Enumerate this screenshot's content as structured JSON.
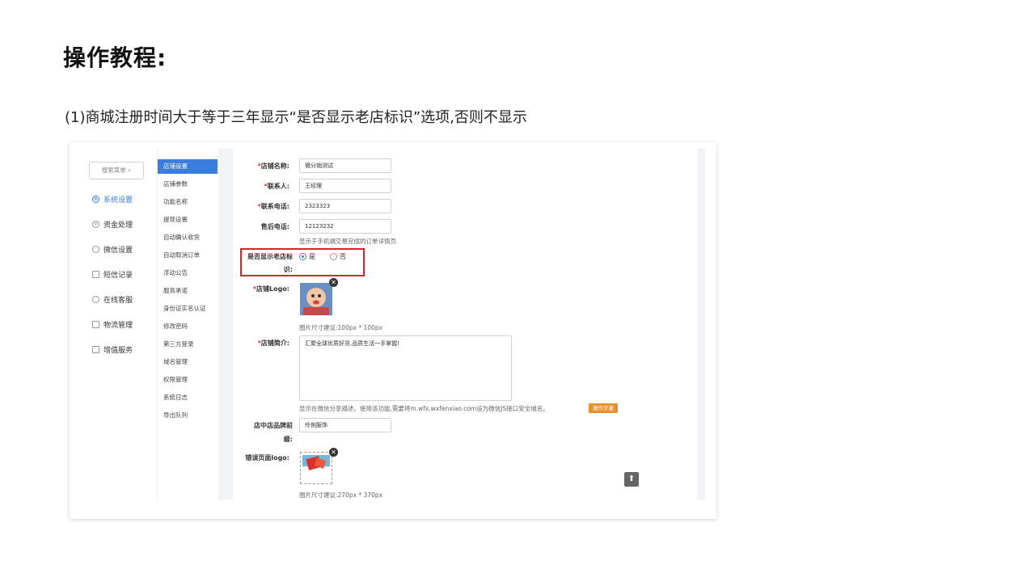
{
  "page": {
    "title": "操作教程:",
    "intro": "(1)商城注册时间大于等于三年显示“是否显示老店标识”选项,否则不显示"
  },
  "nav": {
    "search_placeholder": "搜索菜单 ⌕",
    "items": [
      {
        "label": "系统设置",
        "icon": "gear-icon",
        "active": true
      },
      {
        "label": "资金处理",
        "icon": "coin-icon",
        "active": false
      },
      {
        "label": "微信设置",
        "icon": "wechat-icon",
        "active": false
      },
      {
        "label": "短信记录",
        "icon": "mail-icon",
        "active": false
      },
      {
        "label": "在线客服",
        "icon": "headset-icon",
        "active": false
      },
      {
        "label": "物流管理",
        "icon": "truck-icon",
        "active": false
      },
      {
        "label": "增值服务",
        "icon": "chart-icon",
        "active": false
      }
    ]
  },
  "submenu": {
    "items": [
      "店铺设置",
      "店铺参数",
      "功能名称",
      "提现设置",
      "自动确认收货",
      "自动取消订单",
      "浮动公告",
      "服务承诺",
      "身份证实名认证",
      "修改密码",
      "第三方登录",
      "域名管理",
      "权限管理",
      "系统日志",
      "导出队列"
    ],
    "active_index": 0
  },
  "form": {
    "shop_name_label": "店铺名称:",
    "shop_name_value": "微分销测试",
    "contact_label": "联系人:",
    "contact_value": "王经理",
    "phone_label": "联系电话:",
    "phone_value": "2323323",
    "after_sale_label": "售后电话:",
    "after_sale_value": "12123232",
    "after_sale_hint": "显示于手机端交易完成的订单详情页",
    "old_shop_label_1": "是否显示老店标",
    "old_shop_label_2": "识:",
    "old_shop_yes": "是",
    "old_shop_no": "否",
    "old_shop_selected": "是",
    "logo_label": "店铺Logo:",
    "logo_hint": "图片尺寸建议:100px * 100px",
    "intro_label": "店铺简介:",
    "intro_value": "汇聚全球优质好货,品质生活一手掌握!",
    "intro_hint": "显示在微信分享描述。使用该功能,需要将m.wfx.wxfenxiao.com设为微信JS接口安全域名。",
    "steps_button": "操作步骤",
    "brand_prefix_label_1": "店中店品牌前",
    "brand_prefix_label_2": "缀:",
    "brand_prefix_value": "伶俐服饰",
    "error_logo_label": "错误页面logo:",
    "error_logo_hint": "图片尺寸建议:270px * 370px",
    "close_glyph": "✕",
    "up_glyph": "⬆",
    "required_mark": "*"
  },
  "colors": {
    "accent": "#3b7ddd",
    "highlight_border": "#d9262c",
    "orange_button": "#e8912d"
  }
}
